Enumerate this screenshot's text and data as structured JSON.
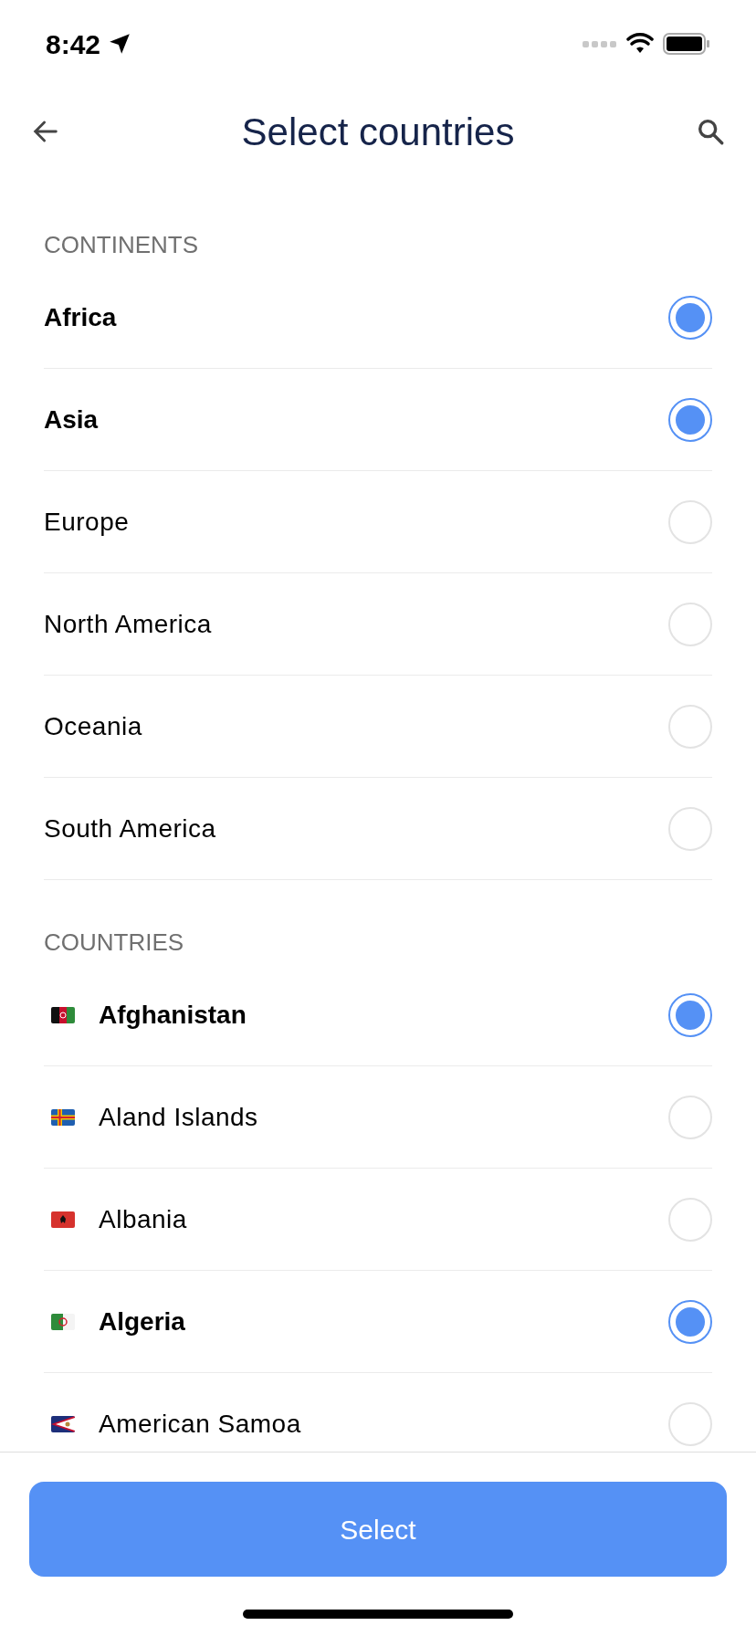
{
  "status_bar": {
    "time": "8:42"
  },
  "header": {
    "title": "Select countries"
  },
  "continents": {
    "heading": "CONTINENTS",
    "items": [
      {
        "label": "Africa",
        "selected": true
      },
      {
        "label": "Asia",
        "selected": true
      },
      {
        "label": "Europe",
        "selected": false
      },
      {
        "label": "North America",
        "selected": false
      },
      {
        "label": "Oceania",
        "selected": false
      },
      {
        "label": "South America",
        "selected": false
      }
    ]
  },
  "countries": {
    "heading": "COUNTRIES",
    "items": [
      {
        "label": "Afghanistan",
        "selected": true
      },
      {
        "label": "Aland Islands",
        "selected": false
      },
      {
        "label": "Albania",
        "selected": false
      },
      {
        "label": "Algeria",
        "selected": true
      },
      {
        "label": "American Samoa",
        "selected": false
      }
    ]
  },
  "footer": {
    "button": "Select"
  }
}
